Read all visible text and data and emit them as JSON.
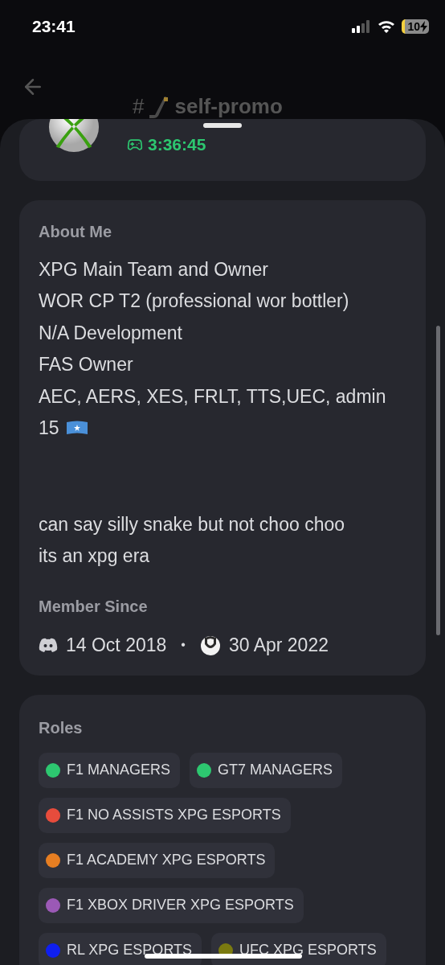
{
  "status_bar": {
    "time": "23:41",
    "battery": "10"
  },
  "header": {
    "hash": "#",
    "channel": "self-promo"
  },
  "profile": {
    "activity_time": "3:36:45"
  },
  "about": {
    "heading": "About Me",
    "paragraphs": [
      [
        "XPG Main Team and Owner",
        "WOR CP T2 (professional wor bottler)",
        "N/A Development",
        "FAS Owner",
        "AEC, AERS, XES, FRLT, TTS,UEC, admin",
        "15"
      ],
      [
        "can say silly snake but not choo choo",
        "its an xpg era"
      ]
    ]
  },
  "member_since": {
    "heading": "Member Since",
    "discord_date": "14 Oct 2018",
    "separator": "•",
    "server_date": "30 Apr 2022"
  },
  "roles": {
    "heading": "Roles",
    "items": [
      {
        "name": "F1 MANAGERS",
        "color": "#2dc770"
      },
      {
        "name": "GT7 MANAGERS",
        "color": "#2dc770"
      },
      {
        "name": "F1 NO ASSISTS XPG ESPORTS",
        "color": "#e74c3c"
      },
      {
        "name": "F1 ACADEMY XPG ESPORTS",
        "color": "#e67e22"
      },
      {
        "name": "F1 XBOX DRIVER XPG ESPORTS",
        "color": "#9b59b6"
      },
      {
        "name": "RL XPG ESPORTS",
        "color": "#0f1ff0"
      },
      {
        "name": "UFC XPG ESPORTS",
        "color": "#7a7a10"
      }
    ]
  }
}
